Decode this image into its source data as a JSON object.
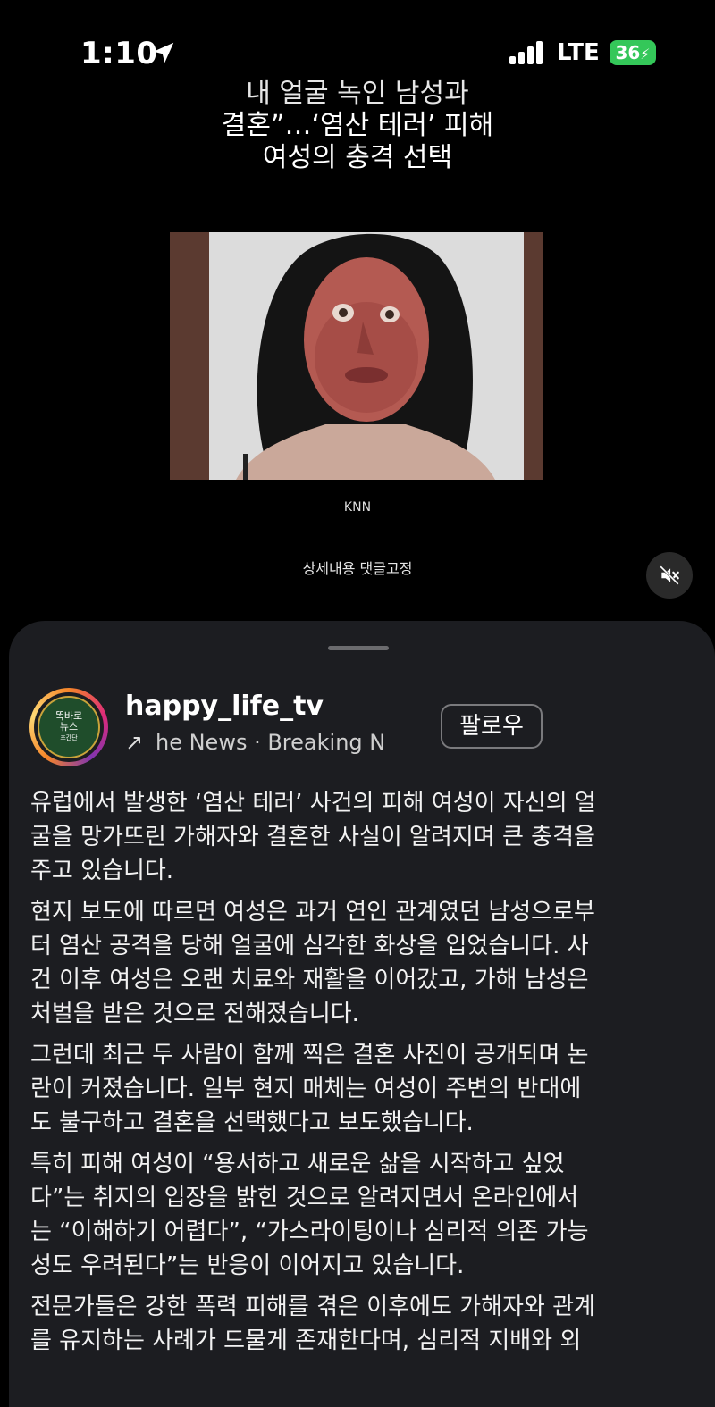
{
  "status": {
    "time": "1:10",
    "network": "LTE",
    "battery": "36"
  },
  "video": {
    "headline_lines": [
      "내 얼굴 녹인 남성과",
      "결혼”…‘염산 테러’ 피해",
      "여성의 충격 선택"
    ],
    "photo_caption": "KNN",
    "pinned_note": "상세내용 댓글고정",
    "mute_icon": "speaker-muted-icon"
  },
  "post": {
    "avatar_text": [
      "똑바로",
      "뉴스",
      "초간단"
    ],
    "username": "happy_life_tv",
    "audio_label": "he News · Breaking N",
    "follow_label": "팔로우",
    "paragraphs": [
      [
        "유럽에서 발생한 ‘염산 테러’ 사건의 피해 여성이 자신의 얼",
        "굴을 망가뜨린 가해자와 결혼한 사실이 알려지며 큰 충격을",
        "주고 있습니다."
      ],
      [
        "현지 보도에 따르면 여성은 과거 연인 관계였던 남성으로부",
        "터 염산 공격을 당해 얼굴에 심각한 화상을 입었습니다. 사",
        "건 이후 여성은 오랜 치료와 재활을 이어갔고, 가해 남성은",
        "처벌을 받은 것으로 전해졌습니다."
      ],
      [
        "그런데 최근 두 사람이 함께 찍은 결혼 사진이 공개되며 논",
        "란이 커졌습니다. 일부 현지 매체는 여성이 주변의 반대에",
        "도 불구하고 결혼을 선택했다고 보도했습니다."
      ],
      [
        "특히 피해 여성이 “용서하고 새로운 삶을 시작하고 싶었",
        "다”는 취지의 입장을 밝힌 것으로 알려지면서 온라인에서",
        "는 “이해하기 어렵다”, “가스라이팅이나 심리적 의존 가능",
        "성도 우려된다”는 반응이 이어지고 있습니다."
      ],
      [
        "전문가들은 강한 폭력 피해를 겪은 이후에도 가해자와 관계",
        "를 유지하는 사례가 드물게 존재한다며, 심리적 지배와 외"
      ]
    ]
  }
}
